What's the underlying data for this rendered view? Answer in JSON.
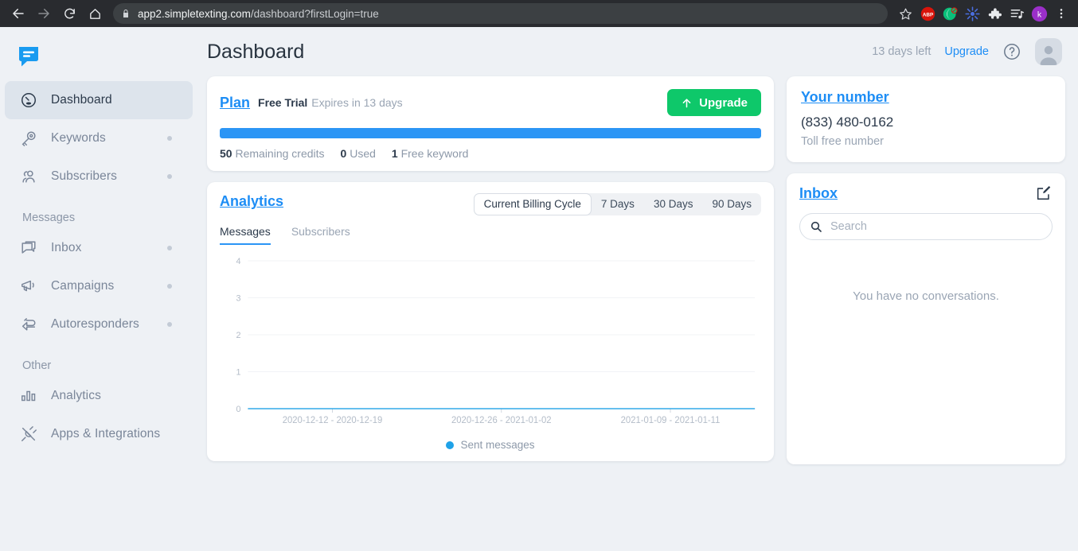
{
  "browser": {
    "url_host": "app2.simpletexting.com",
    "url_path": "/dashboard?firstLogin=true",
    "back_label": "Back",
    "forward_label": "Forward",
    "reload_label": "Reload",
    "home_label": "Home",
    "bookmark_label": "Bookmark this page",
    "extensions": [
      {
        "name": "adblock-plus-icon",
        "label": "ABP"
      },
      {
        "name": "night-mode-icon",
        "label": ""
      },
      {
        "name": "asterisk-extension-icon",
        "label": ""
      },
      {
        "name": "puzzle-extensions-icon",
        "label": ""
      },
      {
        "name": "playlist-icon",
        "label": ""
      }
    ],
    "profile_initial": "k",
    "menu_label": "Customize and control"
  },
  "sidebar": {
    "logo_name": "simpletexting-logo",
    "items": [
      {
        "label": "Dashboard",
        "icon": "gauge-icon",
        "active": true,
        "dot": false
      },
      {
        "label": "Keywords",
        "icon": "key-icon",
        "active": false,
        "dot": true
      },
      {
        "label": "Subscribers",
        "icon": "people-icon",
        "active": false,
        "dot": true
      }
    ],
    "section_messages": "Messages",
    "message_items": [
      {
        "label": "Inbox",
        "icon": "chat-icon",
        "active": false,
        "dot": true
      },
      {
        "label": "Campaigns",
        "icon": "megaphone-icon",
        "active": false,
        "dot": true
      },
      {
        "label": "Autoresponders",
        "icon": "reply-icon",
        "active": false,
        "dot": true
      }
    ],
    "section_other": "Other",
    "other_items": [
      {
        "label": "Analytics",
        "icon": "bar-chart-icon",
        "active": false,
        "dot": false
      },
      {
        "label": "Apps & Integrations",
        "icon": "plug-icon",
        "active": false,
        "dot": false
      }
    ]
  },
  "header": {
    "title": "Dashboard",
    "days_left": "13 days left",
    "upgrade_label": "Upgrade",
    "help_label": "Help",
    "avatar_label": "Account"
  },
  "plan": {
    "link_label": "Plan",
    "type": "Free Trial",
    "expiry": "Expires in 13 days",
    "upgrade_label": "Upgrade",
    "progress_percent": 100,
    "stats": [
      {
        "value": "50",
        "label": "Remaining credits"
      },
      {
        "value": "0",
        "label": "Used"
      },
      {
        "value": "1",
        "label": "Free keyword"
      }
    ]
  },
  "analytics": {
    "link_label": "Analytics",
    "ranges": [
      {
        "label": "Current Billing Cycle",
        "selected": true
      },
      {
        "label": "7 Days",
        "selected": false
      },
      {
        "label": "30 Days",
        "selected": false
      },
      {
        "label": "90 Days",
        "selected": false
      }
    ],
    "tabs": [
      {
        "label": "Messages",
        "active": true
      },
      {
        "label": "Subscribers",
        "active": false
      }
    ]
  },
  "chart_data": {
    "type": "line",
    "title": "",
    "xlabel": "",
    "ylabel": "",
    "ylim": [
      0,
      4
    ],
    "yticks": [
      "0",
      "1",
      "2",
      "3",
      "4"
    ],
    "grid": true,
    "legend_position": "bottom",
    "x_tick_labels": [
      "2020-12-12 - 2020-12-19",
      "2020-12-26 - 2021-01-02",
      "2021-01-09 - 2021-01-11"
    ],
    "series": [
      {
        "name": "Sent messages",
        "color": "#1fa2e8",
        "values": [
          0,
          0,
          0,
          0,
          0,
          0,
          0
        ]
      }
    ]
  },
  "your_number": {
    "link_label": "Your number",
    "number": "(833) 480-0162",
    "note": "Toll free number"
  },
  "inbox": {
    "link_label": "Inbox",
    "compose_label": "Compose",
    "search_value": "",
    "search_placeholder": "Search",
    "empty_text": "You have no conversations."
  },
  "colors": {
    "accent_blue": "#1d8df5",
    "progress_blue": "#2b95f5",
    "upgrade_green": "#0ec86a",
    "series_blue": "#1fa2e8",
    "page_bg": "#eef1f5"
  }
}
